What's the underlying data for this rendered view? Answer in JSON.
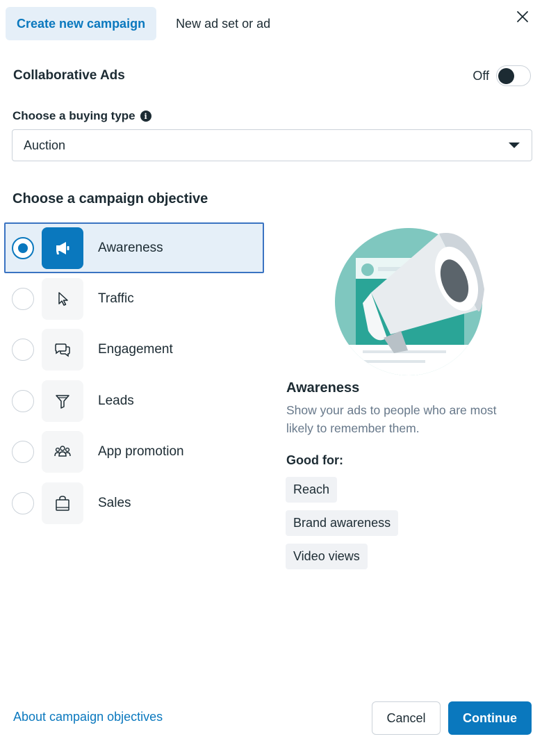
{
  "tabs": [
    {
      "label": "Create new campaign",
      "active": true
    },
    {
      "label": "New ad set or ad",
      "active": false
    }
  ],
  "collaborative_ads": {
    "title": "Collaborative Ads",
    "toggle_label": "Off"
  },
  "buying_type": {
    "label": "Choose a buying type",
    "info_icon": "i",
    "selected": "Auction"
  },
  "objective_heading": "Choose a campaign objective",
  "objectives": [
    {
      "label": "Awareness",
      "icon": "megaphone-icon",
      "selected": true
    },
    {
      "label": "Traffic",
      "icon": "cursor-icon",
      "selected": false
    },
    {
      "label": "Engagement",
      "icon": "chat-bubbles-icon",
      "selected": false
    },
    {
      "label": "Leads",
      "icon": "funnel-icon",
      "selected": false
    },
    {
      "label": "App promotion",
      "icon": "people-group-icon",
      "selected": false
    },
    {
      "label": "Sales",
      "icon": "shopping-bag-icon",
      "selected": false
    }
  ],
  "detail": {
    "title": "Awareness",
    "description": "Show your ads to people who are most likely to remember them.",
    "good_for_label": "Good for:",
    "good_for": [
      "Reach",
      "Brand awareness",
      "Video views"
    ]
  },
  "footer": {
    "link": "About campaign objectives",
    "cancel": "Cancel",
    "continue": "Continue"
  },
  "colors": {
    "accent": "#0a78be",
    "selected_bg": "#e5eff8",
    "text": "#1c2b33",
    "muted": "#67788a"
  }
}
